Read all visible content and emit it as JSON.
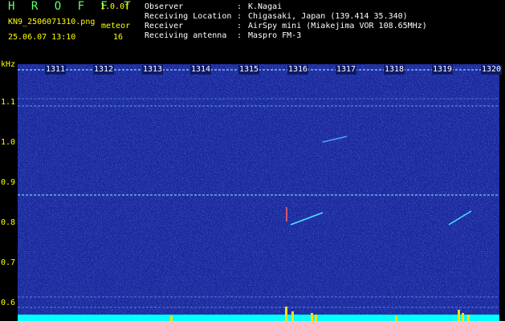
{
  "header": {
    "app_title": "H R O F F T",
    "version": "1.0.0f",
    "filename": "KN9_2506071310.png",
    "datetime": "25.06.07 13:10",
    "meteor_label": "meteor",
    "meteor_count": "16"
  },
  "info": [
    {
      "key": "Observer",
      "sep": ":",
      "value": "K.Nagai"
    },
    {
      "key": "Receiving Location",
      "sep": ":",
      "value": "Chigasaki, Japan (139.414 35.340)"
    },
    {
      "key": "Receiver",
      "sep": ":",
      "value": "AirSpy mini (Miakejima VOR 108.65MHz)"
    },
    {
      "key": "Receiving antenna",
      "sep": ":",
      "value": "Maspro FM-3"
    }
  ],
  "axis": {
    "unit": "kHz",
    "ticks": [
      "1.1",
      "1.0",
      "0.9",
      "0.8",
      "0.7",
      "0.6"
    ]
  },
  "time_labels": [
    "1311",
    "1312",
    "1313",
    "1314",
    "1315",
    "1316",
    "1317",
    "1318",
    "1319",
    "1320"
  ],
  "colors": {
    "background": "#1a2a9e",
    "line": "#8ac8ff",
    "label_yellow": "#ffff00",
    "title_green": "#66ff66",
    "signal_cyan": "#00ffff"
  }
}
